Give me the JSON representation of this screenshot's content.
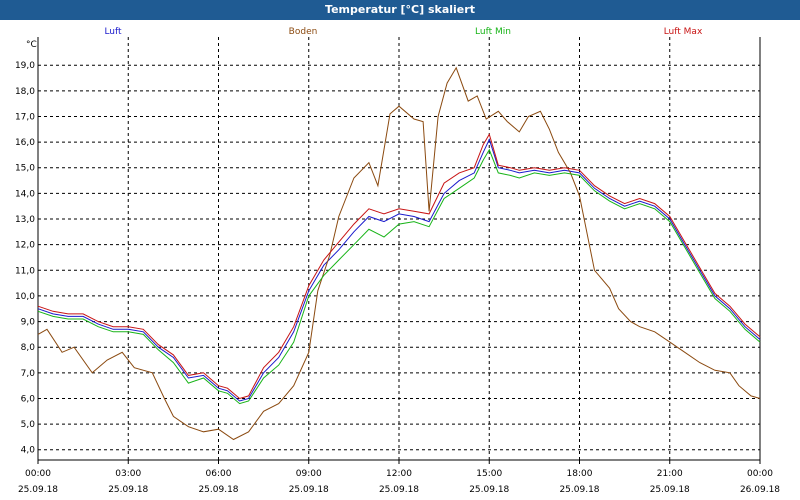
{
  "window": {
    "title": "Temperatur [°C] skaliert"
  },
  "chart_data": {
    "type": "line",
    "title": "Temperatur [°C] skaliert",
    "ylabel": "°C",
    "xlabel": "",
    "ylim": [
      3.6,
      20.1
    ],
    "xlim": [
      0,
      24
    ],
    "grid": true,
    "legend": "top",
    "y_ticks": [
      "4,0",
      "5,0",
      "6,0",
      "7,0",
      "8,0",
      "9,0",
      "10,0",
      "11,0",
      "12,0",
      "13,0",
      "14,0",
      "15,0",
      "16,0",
      "17,0",
      "18,0",
      "19,0"
    ],
    "y_tick_values": [
      4,
      5,
      6,
      7,
      8,
      9,
      10,
      11,
      12,
      13,
      14,
      15,
      16,
      17,
      18,
      19
    ],
    "x_ticks": [
      {
        "time": "00:00",
        "date": "25.09.18"
      },
      {
        "time": "03:00",
        "date": "25.09.18"
      },
      {
        "time": "06:00",
        "date": "25.09.18"
      },
      {
        "time": "09:00",
        "date": "25.09.18"
      },
      {
        "time": "12:00",
        "date": "25.09.18"
      },
      {
        "time": "15:00",
        "date": "25.09.18"
      },
      {
        "time": "18:00",
        "date": "25.09.18"
      },
      {
        "time": "21:00",
        "date": "25.09.18"
      },
      {
        "time": "00:00",
        "date": "26.09.18"
      }
    ],
    "x_tick_hours": [
      0,
      3,
      6,
      9,
      12,
      15,
      18,
      21,
      24
    ],
    "series": [
      {
        "name": "Luft",
        "color": "#1a1acc",
        "x": [
          0,
          0.5,
          1,
          1.5,
          2,
          2.5,
          3,
          3.5,
          4,
          4.5,
          5,
          5.5,
          6,
          6.3,
          6.7,
          7,
          7.5,
          8,
          8.5,
          9,
          9.5,
          10,
          10.5,
          11,
          11.5,
          12,
          12.5,
          13,
          13.5,
          14,
          14.5,
          14.8,
          15,
          15.3,
          15.7,
          16,
          16.5,
          17,
          17.5,
          18,
          18.5,
          19,
          19.5,
          20,
          20.5,
          21,
          21.5,
          22,
          22.5,
          23,
          23.5,
          24
        ],
        "values": [
          9.5,
          9.3,
          9.2,
          9.2,
          8.9,
          8.7,
          8.7,
          8.6,
          8.0,
          7.6,
          6.8,
          6.9,
          6.4,
          6.3,
          5.9,
          6.0,
          7.0,
          7.6,
          8.6,
          10.2,
          11.2,
          11.8,
          12.5,
          13.1,
          12.9,
          13.2,
          13.1,
          12.9,
          14.0,
          14.5,
          14.8,
          15.6,
          16.1,
          15.0,
          14.9,
          14.8,
          14.9,
          14.8,
          14.9,
          14.8,
          14.2,
          13.8,
          13.5,
          13.7,
          13.5,
          13.0,
          12.0,
          11.0,
          10.0,
          9.5,
          8.8,
          8.3
        ]
      },
      {
        "name": "Boden",
        "color": "#8b4a10",
        "x": [
          0,
          0.3,
          0.8,
          1.2,
          1.8,
          2.3,
          2.8,
          3.2,
          3.8,
          4.2,
          4.5,
          5,
          5.5,
          6,
          6.5,
          7,
          7.5,
          8,
          8.5,
          9,
          9.3,
          9.7,
          10,
          10.5,
          11,
          11.3,
          11.7,
          12,
          12.5,
          12.8,
          13,
          13.3,
          13.6,
          13.9,
          14.3,
          14.6,
          14.9,
          15.3,
          15.6,
          16,
          16.3,
          16.7,
          17,
          17.3,
          17.7,
          18,
          18.5,
          19,
          19.3,
          19.7,
          20,
          20.5,
          21,
          21.5,
          22,
          22.5,
          23,
          23.3,
          23.7,
          24
        ],
        "values": [
          8.5,
          8.7,
          7.8,
          8.0,
          7.0,
          7.5,
          7.8,
          7.2,
          7.0,
          6.0,
          5.3,
          4.9,
          4.7,
          4.8,
          4.4,
          4.7,
          5.5,
          5.8,
          6.5,
          7.8,
          10.2,
          11.6,
          13.1,
          14.6,
          15.2,
          14.3,
          17.1,
          17.4,
          16.9,
          16.8,
          13.3,
          17.0,
          18.3,
          18.9,
          17.6,
          17.8,
          16.9,
          17.2,
          16.8,
          16.4,
          17.0,
          17.2,
          16.5,
          15.6,
          14.8,
          13.9,
          11.0,
          10.3,
          9.5,
          9.0,
          8.8,
          8.6,
          8.2,
          7.8,
          7.4,
          7.1,
          7.0,
          6.5,
          6.1,
          6.0
        ]
      },
      {
        "name": "Luft Min",
        "color": "#18b418",
        "x": [
          0,
          0.5,
          1,
          1.5,
          2,
          2.5,
          3,
          3.5,
          4,
          4.5,
          5,
          5.5,
          6,
          6.3,
          6.7,
          7,
          7.5,
          8,
          8.5,
          9,
          9.5,
          10,
          10.5,
          11,
          11.5,
          12,
          12.5,
          13,
          13.5,
          14,
          14.5,
          14.8,
          15,
          15.3,
          15.7,
          16,
          16.5,
          17,
          17.5,
          18,
          18.5,
          19,
          19.5,
          20,
          20.5,
          21,
          21.5,
          22,
          22.5,
          23,
          23.5,
          24
        ],
        "values": [
          9.4,
          9.2,
          9.1,
          9.1,
          8.8,
          8.6,
          8.6,
          8.5,
          7.9,
          7.4,
          6.6,
          6.8,
          6.3,
          6.2,
          5.8,
          5.9,
          6.8,
          7.3,
          8.2,
          10.0,
          10.8,
          11.4,
          12.0,
          12.6,
          12.3,
          12.8,
          12.9,
          12.7,
          13.8,
          14.2,
          14.6,
          15.3,
          15.7,
          14.8,
          14.7,
          14.6,
          14.8,
          14.7,
          14.8,
          14.7,
          14.1,
          13.7,
          13.4,
          13.6,
          13.4,
          12.9,
          11.9,
          10.9,
          9.9,
          9.4,
          8.7,
          8.2
        ]
      },
      {
        "name": "Luft Max",
        "color": "#c81414",
        "x": [
          0,
          0.5,
          1,
          1.5,
          2,
          2.5,
          3,
          3.5,
          4,
          4.5,
          5,
          5.5,
          6,
          6.3,
          6.7,
          7,
          7.5,
          8,
          8.5,
          9,
          9.5,
          10,
          10.5,
          11,
          11.5,
          12,
          12.5,
          13,
          13.5,
          14,
          14.5,
          14.8,
          15,
          15.3,
          15.7,
          16,
          16.5,
          17,
          17.5,
          18,
          18.5,
          19,
          19.5,
          20,
          20.5,
          21,
          21.5,
          22,
          22.5,
          23,
          23.5,
          24
        ],
        "values": [
          9.6,
          9.4,
          9.3,
          9.3,
          9.0,
          8.8,
          8.8,
          8.7,
          8.1,
          7.7,
          6.9,
          7.0,
          6.5,
          6.4,
          6.0,
          6.1,
          7.2,
          7.8,
          8.8,
          10.4,
          11.4,
          12.1,
          12.8,
          13.4,
          13.2,
          13.4,
          13.3,
          13.2,
          14.4,
          14.8,
          15.0,
          15.9,
          16.3,
          15.1,
          15.0,
          14.9,
          15.0,
          14.9,
          15.0,
          14.9,
          14.3,
          13.9,
          13.6,
          13.8,
          13.6,
          13.1,
          12.1,
          11.1,
          10.1,
          9.6,
          8.9,
          8.4
        ]
      }
    ]
  }
}
